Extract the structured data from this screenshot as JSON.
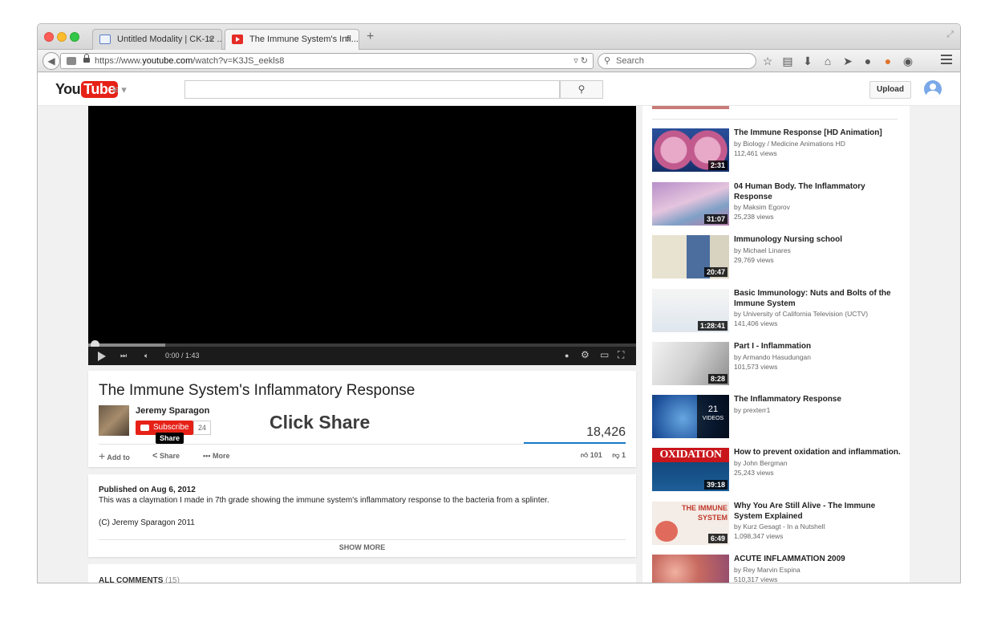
{
  "browser": {
    "tabs": [
      {
        "label": "Untitled Modality | CK-12 ..."
      },
      {
        "label": "The Immune System's Infl..."
      }
    ],
    "url_prefix": "https://www.",
    "url_host": "youtube.com",
    "url_path": "/watch?v=K3JS_eekls8",
    "search_placeholder": "Search"
  },
  "yt": {
    "logo_you": "You",
    "logo_tube": "Tube",
    "upload_label": "Upload"
  },
  "player": {
    "time": "0:00 / 1:43",
    "progress_loaded_fraction": 0.14
  },
  "video": {
    "title": "The Immune System's Inflammatory Response",
    "owner": "Jeremy Sparagon",
    "subscribe_label": "Subscribe",
    "subscriber_count": "24",
    "share_tooltip": "Share",
    "overlay_caption": "Click Share",
    "views": "18,426",
    "add_to_label": "Add to",
    "share_label": "Share",
    "more_label": "More",
    "likes": "101",
    "dislikes": "1"
  },
  "description": {
    "published": "Published on Aug 6, 2012",
    "text": "This was a claymation I made in 7th grade showing the immune system's inflammatory response to the bacteria from a splinter.",
    "copyright": "(C) Jeremy Sparagon 2011",
    "show_more": "SHOW MORE"
  },
  "comments": {
    "label": "ALL COMMENTS",
    "count": "(15)"
  },
  "recommendations": [
    {
      "title": "The Immune Response [HD Animation]",
      "by": "by Biology / Medicine Animations HD",
      "views": "112,461 views",
      "duration": "2:31"
    },
    {
      "title": "04 Human Body. The Inflammatory Response",
      "by": "by Maksim Egorov",
      "views": "25,238 views",
      "duration": "31:07"
    },
    {
      "title": "Immunology Nursing school",
      "by": "by Michael Linares",
      "views": "29,769 views",
      "duration": "20:47"
    },
    {
      "title": "Basic Immunology: Nuts and Bolts of the Immune System",
      "by": "by University of California Television (UCTV)",
      "views": "141,406 views",
      "duration": "1:28:41"
    },
    {
      "title": "Part I - Inflammation",
      "by": "by Armando Hasudungan",
      "views": "101,573 views",
      "duration": "8:28"
    },
    {
      "title": "The Inflammatory Response",
      "by": "by prexterr1",
      "views": "",
      "playlist_count": "21",
      "playlist_label": "VIDEOS"
    },
    {
      "title": "How to prevent oxidation and inflammation.",
      "by": "by John Bergman",
      "views": "25,243 views",
      "duration": "39:18",
      "thumb_text": "OXIDATION"
    },
    {
      "title": "Why You Are Still Alive - The Immune System Explained",
      "by": "by Kurz Gesagt - In a Nutshell",
      "views": "1,098,347 views",
      "duration": "6:49",
      "thumb_text": "THE IMMUNE SYSTEM"
    },
    {
      "title": "ACUTE INFLAMMATION 2009",
      "by": "by Rey Marvin Espina",
      "views": "510,317 views",
      "duration": ""
    }
  ]
}
